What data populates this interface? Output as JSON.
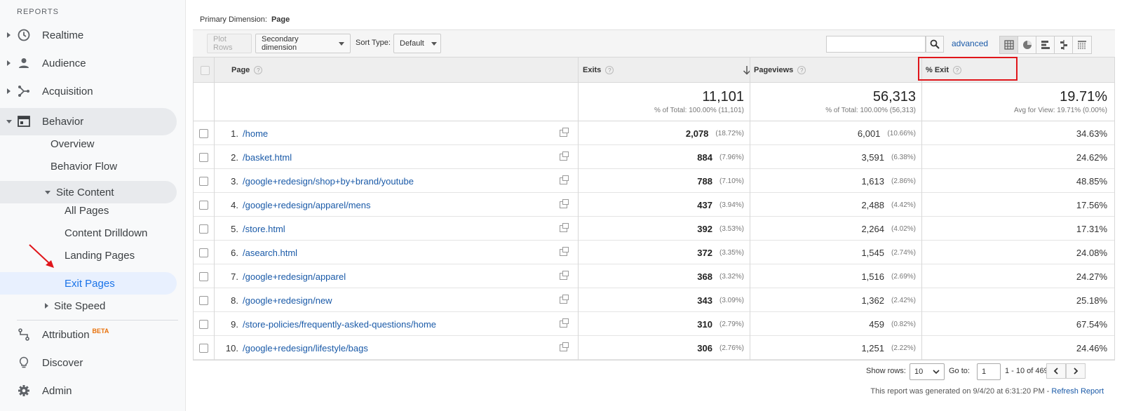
{
  "sidebar": {
    "header": "REPORTS",
    "realtime": "Realtime",
    "audience": "Audience",
    "acquisition": "Acquisition",
    "behavior": "Behavior",
    "overview": "Overview",
    "behavior_flow": "Behavior Flow",
    "site_content": "Site Content",
    "all_pages": "All Pages",
    "content_drilldown": "Content Drilldown",
    "landing_pages": "Landing Pages",
    "exit_pages": "Exit Pages",
    "site_speed": "Site Speed",
    "attribution": "Attribution",
    "attribution_badge": "BETA",
    "discover": "Discover",
    "admin": "Admin"
  },
  "primary_dimension": {
    "label": "Primary Dimension:",
    "value": "Page"
  },
  "toolbar": {
    "plot_rows": "Plot Rows",
    "secondary_dimension": "Secondary dimension",
    "sort_type_label": "Sort Type:",
    "sort_type_value": "Default",
    "search_value": "",
    "advanced": "advanced"
  },
  "table": {
    "headers": {
      "page": "Page",
      "exits": "Exits",
      "pageviews": "Pageviews",
      "exit_pct": "% Exit"
    },
    "totals": {
      "exits": "11,101",
      "exits_sub": "% of Total: 100.00% (11,101)",
      "pageviews": "56,313",
      "pageviews_sub": "% of Total: 100.00% (56,313)",
      "exit_pct": "19.71%",
      "exit_pct_sub": "Avg for View: 19.71% (0.00%)"
    },
    "rows": [
      {
        "num": "1.",
        "page": "/home",
        "exits": "2,078",
        "exits_pct": "(18.72%)",
        "pageviews": "6,001",
        "pageviews_pct": "(10.66%)",
        "exit_rate": "34.63%"
      },
      {
        "num": "2.",
        "page": "/basket.html",
        "exits": "884",
        "exits_pct": "(7.96%)",
        "pageviews": "3,591",
        "pageviews_pct": "(6.38%)",
        "exit_rate": "24.62%"
      },
      {
        "num": "3.",
        "page": "/google+redesign/shop+by+brand/youtube",
        "exits": "788",
        "exits_pct": "(7.10%)",
        "pageviews": "1,613",
        "pageviews_pct": "(2.86%)",
        "exit_rate": "48.85%"
      },
      {
        "num": "4.",
        "page": "/google+redesign/apparel/mens",
        "exits": "437",
        "exits_pct": "(3.94%)",
        "pageviews": "2,488",
        "pageviews_pct": "(4.42%)",
        "exit_rate": "17.56%"
      },
      {
        "num": "5.",
        "page": "/store.html",
        "exits": "392",
        "exits_pct": "(3.53%)",
        "pageviews": "2,264",
        "pageviews_pct": "(4.02%)",
        "exit_rate": "17.31%"
      },
      {
        "num": "6.",
        "page": "/asearch.html",
        "exits": "372",
        "exits_pct": "(3.35%)",
        "pageviews": "1,545",
        "pageviews_pct": "(2.74%)",
        "exit_rate": "24.08%"
      },
      {
        "num": "7.",
        "page": "/google+redesign/apparel",
        "exits": "368",
        "exits_pct": "(3.32%)",
        "pageviews": "1,516",
        "pageviews_pct": "(2.69%)",
        "exit_rate": "24.27%"
      },
      {
        "num": "8.",
        "page": "/google+redesign/new",
        "exits": "343",
        "exits_pct": "(3.09%)",
        "pageviews": "1,362",
        "pageviews_pct": "(2.42%)",
        "exit_rate": "25.18%"
      },
      {
        "num": "9.",
        "page": "/store-policies/frequently-asked-questions/home",
        "exits": "310",
        "exits_pct": "(2.79%)",
        "pageviews": "459",
        "pageviews_pct": "(0.82%)",
        "exit_rate": "67.54%"
      },
      {
        "num": "10.",
        "page": "/google+redesign/lifestyle/bags",
        "exits": "306",
        "exits_pct": "(2.76%)",
        "pageviews": "1,251",
        "pageviews_pct": "(2.22%)",
        "exit_rate": "24.46%"
      }
    ]
  },
  "pagination": {
    "show_rows_label": "Show rows:",
    "show_rows_value": "10",
    "goto_label": "Go to:",
    "goto_value": "1",
    "range": "1 - 10 of 469"
  },
  "report_generated": "This report was generated on 9/4/20 at 6:31:20 PM -",
  "refresh_report": "Refresh Report",
  "colors": {
    "link": "#1a5aa8",
    "active_nav": "#1a73e8",
    "highlight": "#e0161b",
    "annotation_arrow": "#e0161b"
  }
}
